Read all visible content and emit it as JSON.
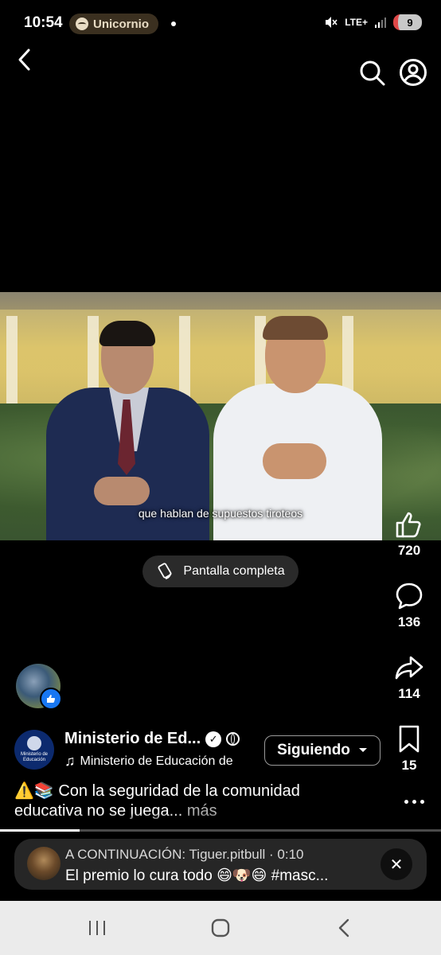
{
  "status_bar": {
    "time": "10:54",
    "spotify_label": "Unicornio",
    "network": "LTE+",
    "battery": "9"
  },
  "video": {
    "caption": "que hablan de supuestos tiroteos"
  },
  "fullscreen": {
    "label": "Pantalla completa"
  },
  "actions": {
    "likes": "720",
    "comments": "136",
    "shares": "114",
    "saves": "15"
  },
  "page": {
    "logo_text": "Ministerio de Educación",
    "name": "Ministerio de Ed...",
    "audio": "Ministerio de Educación de",
    "follow_label": "Siguiendo"
  },
  "description": {
    "text": "⚠️📚 Con la seguridad de la comunidad educativa no se juega...",
    "more": "más"
  },
  "progress": {
    "fraction": 0.18
  },
  "up_next": {
    "line1": "A CONTINUACIÓN: Tiguer.pitbull · 0:10",
    "line2": "El premio lo cura todo 😄🐶😄 #masc..."
  },
  "colors": {
    "accent_blue": "#1877f2",
    "background": "#000000"
  }
}
